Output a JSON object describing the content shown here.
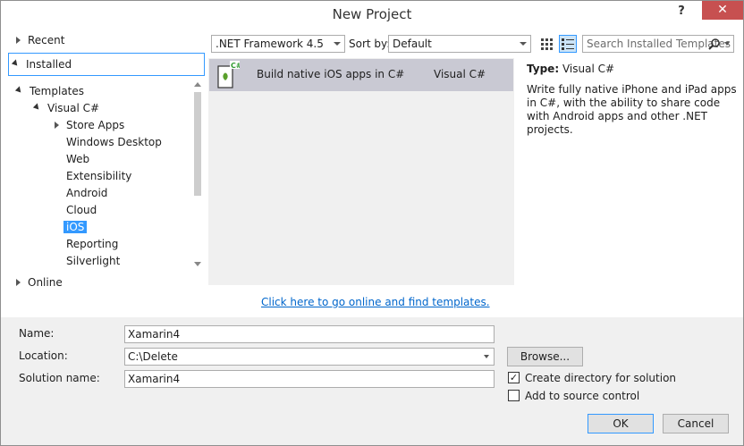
{
  "window": {
    "title": "New Project",
    "help_label": "?",
    "close_label": "✕"
  },
  "nav": {
    "recent": "Recent",
    "installed": "Installed",
    "online": "Online",
    "tree": {
      "templates": "Templates",
      "visual_csharp": "Visual C#",
      "items": [
        "Store Apps",
        "Windows Desktop",
        "Web",
        "Extensibility",
        "Android",
        "Cloud",
        "iOS",
        "Reporting",
        "Silverlight"
      ],
      "selected": "iOS"
    }
  },
  "toolbar": {
    "framework": ".NET Framework 4.5",
    "sort_label": "Sort by:",
    "sort_value": "Default",
    "search_placeholder": "Search Installed Templates (Ctrl+E)"
  },
  "templates": [
    {
      "name": "Build native iOS apps in C#",
      "language": "Visual C#",
      "icon_badge": "C#"
    }
  ],
  "details": {
    "type_label": "Type:",
    "type_value": "Visual C#",
    "description": "Write fully native iPhone and iPad apps in C#, with the ability to share code with Android apps and other .NET projects."
  },
  "online_link": "Click here to go online and find templates.",
  "form": {
    "name_label": "Name:",
    "name_value": "Xamarin4",
    "location_label": "Location:",
    "location_value": "C:\\Delete",
    "solution_label": "Solution name:",
    "solution_value": "Xamarin4",
    "browse": "Browse...",
    "create_dir": "Create directory for solution",
    "create_dir_checked": true,
    "source_control": "Add to source control",
    "source_control_checked": false,
    "ok": "OK",
    "cancel": "Cancel"
  },
  "colors": {
    "selection": "#3399ff",
    "link": "#0066cc",
    "close": "#c75050",
    "template_row": "#c9c9d3"
  }
}
